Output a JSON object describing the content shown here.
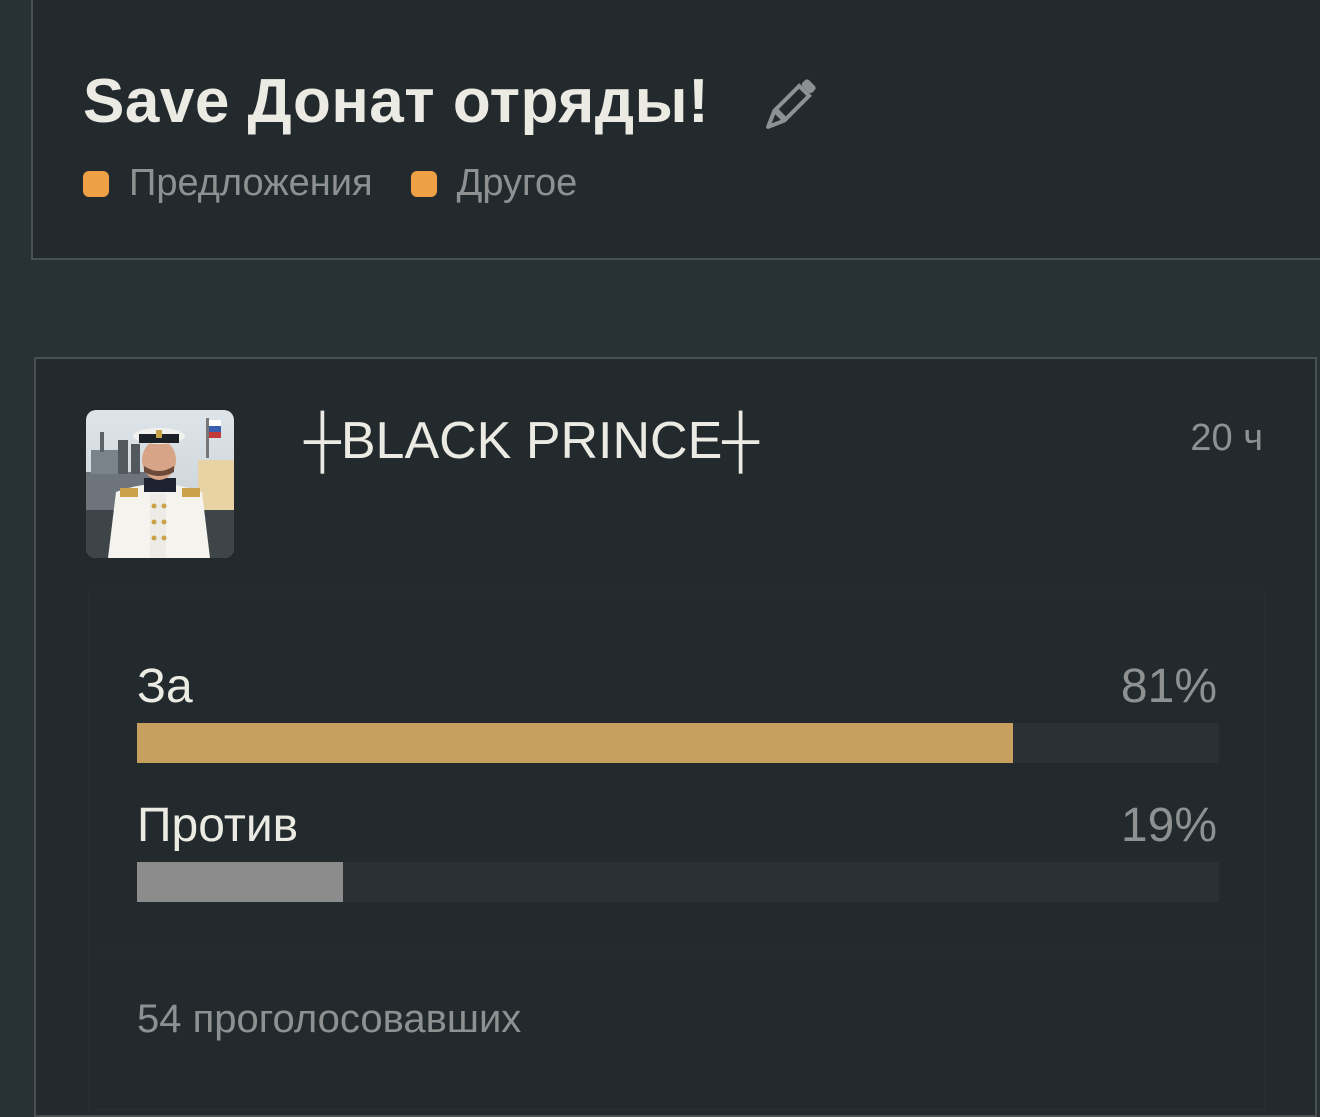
{
  "topic": {
    "title": "Save Донат отряды!",
    "tags": [
      {
        "label": "Предложения",
        "color": "#eea046"
      },
      {
        "label": "Другое",
        "color": "#eea046"
      }
    ],
    "edit_icon": "pencil-icon"
  },
  "post": {
    "author": "┼BLACK PRINCE┼",
    "time": "20 ч",
    "poll": {
      "options": [
        {
          "label": "За",
          "percent_text": "81%",
          "percent": 81,
          "color": "#c7a060"
        },
        {
          "label": "Против",
          "percent_text": "19%",
          "percent": 19,
          "color": "#8c8c8c"
        }
      ],
      "voters": "54 проголосовавших"
    }
  },
  "colors": {
    "background": "#283235",
    "card": "#232a2e",
    "border": "#4a4f4f",
    "text_primary": "#ecebe3",
    "text_secondary": "#8d9191",
    "tag_accent": "#eea046"
  }
}
